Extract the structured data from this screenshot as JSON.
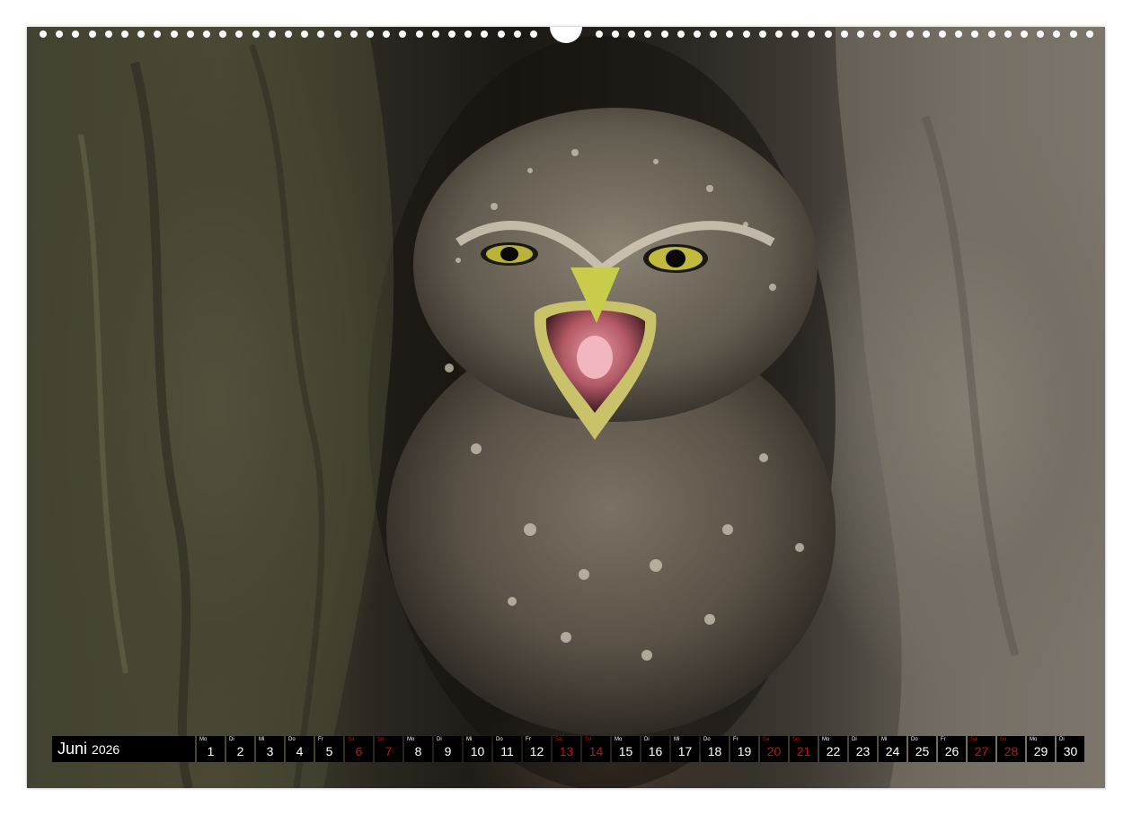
{
  "calendar": {
    "month": "Juni",
    "year": "2026",
    "days": [
      {
        "wd": "Mo",
        "num": "1",
        "weekend": false
      },
      {
        "wd": "Di",
        "num": "2",
        "weekend": false
      },
      {
        "wd": "Mi",
        "num": "3",
        "weekend": false
      },
      {
        "wd": "Do",
        "num": "4",
        "weekend": false
      },
      {
        "wd": "Fr",
        "num": "5",
        "weekend": false
      },
      {
        "wd": "Sa",
        "num": "6",
        "weekend": true
      },
      {
        "wd": "So",
        "num": "7",
        "weekend": true
      },
      {
        "wd": "Mo",
        "num": "8",
        "weekend": false
      },
      {
        "wd": "Di",
        "num": "9",
        "weekend": false
      },
      {
        "wd": "Mi",
        "num": "10",
        "weekend": false
      },
      {
        "wd": "Do",
        "num": "11",
        "weekend": false
      },
      {
        "wd": "Fr",
        "num": "12",
        "weekend": false
      },
      {
        "wd": "Sa",
        "num": "13",
        "weekend": true
      },
      {
        "wd": "So",
        "num": "14",
        "weekend": true
      },
      {
        "wd": "Mo",
        "num": "15",
        "weekend": false
      },
      {
        "wd": "Di",
        "num": "16",
        "weekend": false
      },
      {
        "wd": "Mi",
        "num": "17",
        "weekend": false
      },
      {
        "wd": "Do",
        "num": "18",
        "weekend": false
      },
      {
        "wd": "Fr",
        "num": "19",
        "weekend": false
      },
      {
        "wd": "Sa",
        "num": "20",
        "weekend": true
      },
      {
        "wd": "So",
        "num": "21",
        "weekend": true
      },
      {
        "wd": "Mo",
        "num": "22",
        "weekend": false
      },
      {
        "wd": "Di",
        "num": "23",
        "weekend": false
      },
      {
        "wd": "Mi",
        "num": "24",
        "weekend": false
      },
      {
        "wd": "Do",
        "num": "25",
        "weekend": false
      },
      {
        "wd": "Fr",
        "num": "26",
        "weekend": false
      },
      {
        "wd": "Sa",
        "num": "27",
        "weekend": true
      },
      {
        "wd": "So",
        "num": "28",
        "weekend": true
      },
      {
        "wd": "Mo",
        "num": "29",
        "weekend": false
      },
      {
        "wd": "Di",
        "num": "30",
        "weekend": false
      }
    ]
  },
  "colors": {
    "weekend": "#c0141c",
    "weekday": "#ffffff",
    "cell_background": "#000000"
  },
  "photo": {
    "subject": "owl-chick-icon"
  }
}
